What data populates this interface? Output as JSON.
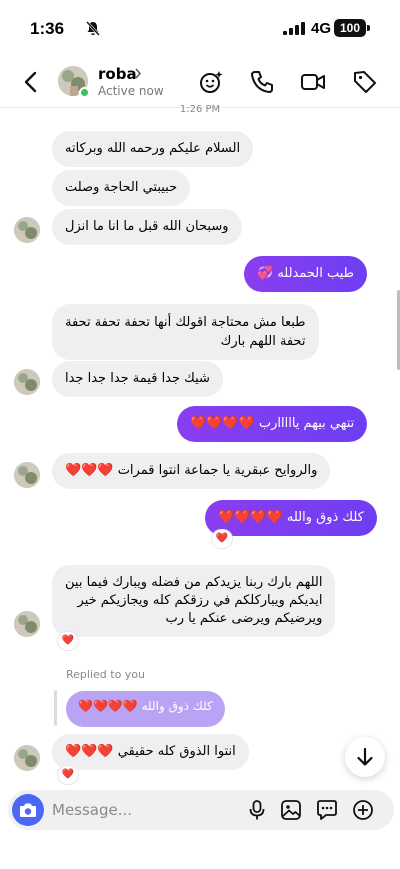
{
  "status_bar": {
    "time": "1:36",
    "network": "4G",
    "battery": "100"
  },
  "header": {
    "name": "roba",
    "status": "Active now"
  },
  "timestamp": "1:26 PM",
  "messages": [
    {
      "text": "السلام عليكم ورحمه الله وبركاته"
    },
    {
      "text": "حبيبتي الحاجة وصلت"
    },
    {
      "text": "وسبحان الله قبل ما انا ما انزل"
    },
    {
      "text": "طيب الحمدلله 💞"
    },
    {
      "line1": "طبعا مش محتاجة اقولك أنها تحفة تحفة تحفة",
      "line2": "تحفة اللهم بارك"
    },
    {
      "text": "شيك جدا قيمة جدا جدا جدا"
    },
    {
      "text": "تتهي بيهم يااااارب ❤️❤️❤️❤️"
    },
    {
      "text": "والروايح عبقرية يا جماعة انتوا قمرات ❤️❤️❤️"
    },
    {
      "text": "كلك ذوق والله ❤️❤️❤️❤️"
    },
    {
      "line1": "اللهم بارك ربنا يزيدكم من فضله ويبارك فيما بين",
      "line2": "ايديكم ويباركلكم في رزقكم كله ويجازيكم خير",
      "line3": "ويرضيكم ويرضى عنكم يا رب"
    },
    {
      "text": "انتوا الذوق كله حقيقي ❤️❤️❤️"
    }
  ],
  "reaction_emoji": "❤️",
  "reply": {
    "label": "Replied to you",
    "quote": "كلك ذوق والله ❤️❤️❤️❤️"
  },
  "composer": {
    "placeholder": "Message..."
  },
  "colors": {
    "accent": "#7a3ff2",
    "camera": "#4a67f5",
    "online": "#36c15b",
    "incoming": "#efeff2"
  }
}
